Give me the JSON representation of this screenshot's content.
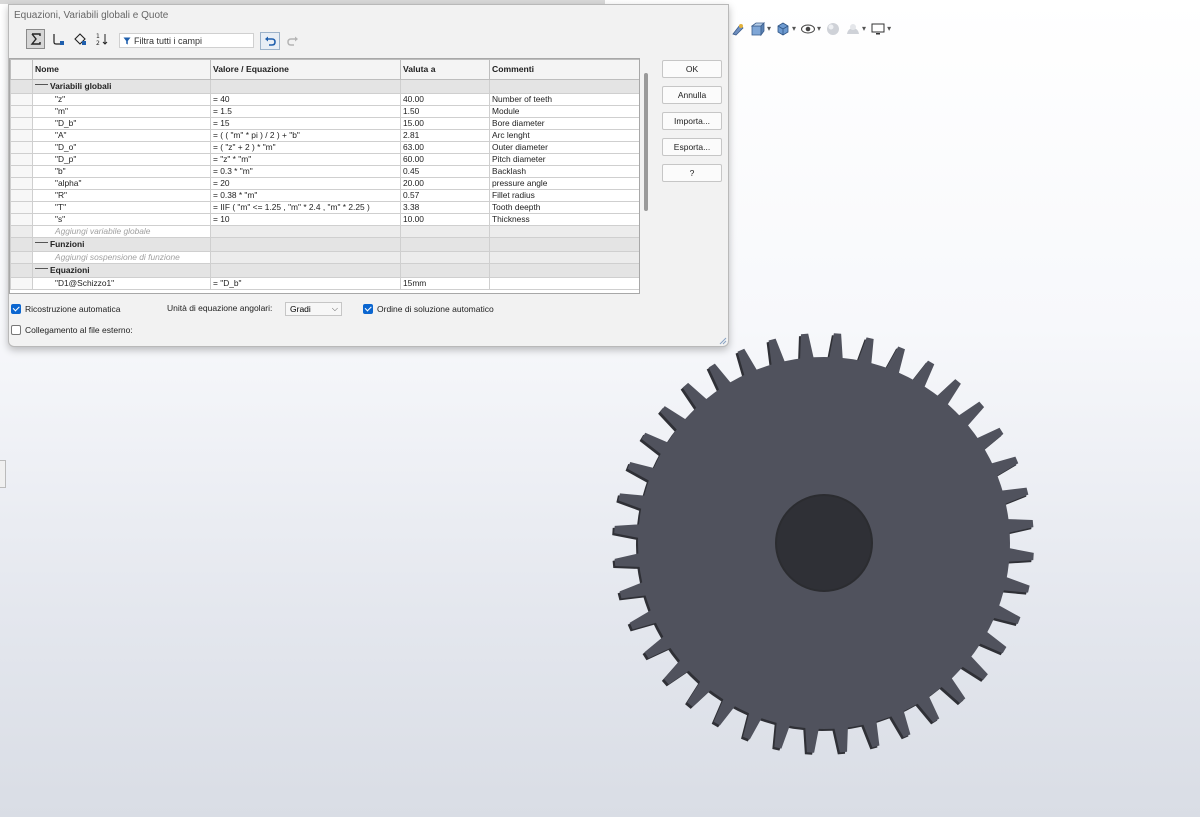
{
  "dialog": {
    "title": "Equazioni, Variabili globali e Quote",
    "filter_placeholder": "Filtra tutti i campi",
    "columns": [
      "Nome",
      "Valore / Equazione",
      "Valuta a",
      "Commenti"
    ],
    "groups": {
      "global_vars": "Variabili globali",
      "functions": "Funzioni",
      "equations": "Equazioni"
    },
    "rows": [
      {
        "name": "\"z\"",
        "value": "= 40",
        "eval": "40.00",
        "comment": "Number of teeth"
      },
      {
        "name": "\"m\"",
        "value": "= 1.5",
        "eval": "1.50",
        "comment": "Module"
      },
      {
        "name": "\"D_b\"",
        "value": "= 15",
        "eval": "15.00",
        "comment": "Bore diameter"
      },
      {
        "name": "\"A\"",
        "value": "= ( ( \"m\" * pi ) / 2 ) + \"b\"",
        "eval": "2.81",
        "comment": "Arc lenght"
      },
      {
        "name": "\"D_o\"",
        "value": "= ( \"z\" + 2 ) * \"m\"",
        "eval": "63.00",
        "comment": "Outer diameter"
      },
      {
        "name": "\"D_p\"",
        "value": "= \"z\" * \"m\"",
        "eval": "60.00",
        "comment": "Pitch diameter"
      },
      {
        "name": "\"b\"",
        "value": "= 0.3 * \"m\"",
        "eval": "0.45",
        "comment": "Backlash"
      },
      {
        "name": "\"alpha\"",
        "value": "= 20",
        "eval": "20.00",
        "comment": "pressure angle"
      },
      {
        "name": "\"R\"",
        "value": "= 0.38 * \"m\"",
        "eval": "0.57",
        "comment": "Fillet radius"
      },
      {
        "name": "\"T\"",
        "value": "= IIF ( \"m\" <= 1.25 , \"m\" * 2.4 , \"m\" * 2.25 )",
        "eval": "3.38",
        "comment": "Tooth deepth"
      },
      {
        "name": "\"s\"",
        "value": "= 10",
        "eval": "10.00",
        "comment": "Thickness"
      }
    ],
    "add_global_var": "Aggiungi variabile globale",
    "add_function": "Aggiungi sospensione di funzione",
    "equation_rows": [
      {
        "name": "\"D1@Schizzo1\"",
        "value": "= \"D_b\"",
        "eval": "15mm",
        "comment": ""
      }
    ],
    "buttons": {
      "ok": "OK",
      "cancel": "Annulla",
      "import": "Importa...",
      "export": "Esporta...",
      "help": "?"
    },
    "options": {
      "auto_rebuild": "Ricostruzione automatica",
      "angular_units_label": "Unità di equazione angolari:",
      "angular_units_value": "Gradi",
      "auto_solve_order": "Ordine di soluzione automatico",
      "link_external": "Collegamento al file esterno:"
    },
    "option_states": {
      "auto_rebuild": true,
      "auto_solve_order": true,
      "link_external": false
    }
  },
  "viewport": {
    "gear_teeth": 40,
    "gear_color": "#50525d",
    "toolbar_icons": [
      "section-view-icon",
      "view-orientation-icon",
      "display-style-icon",
      "hide-show-icon",
      "edit-appearance-icon",
      "apply-scene-icon",
      "view-settings-icon"
    ]
  }
}
